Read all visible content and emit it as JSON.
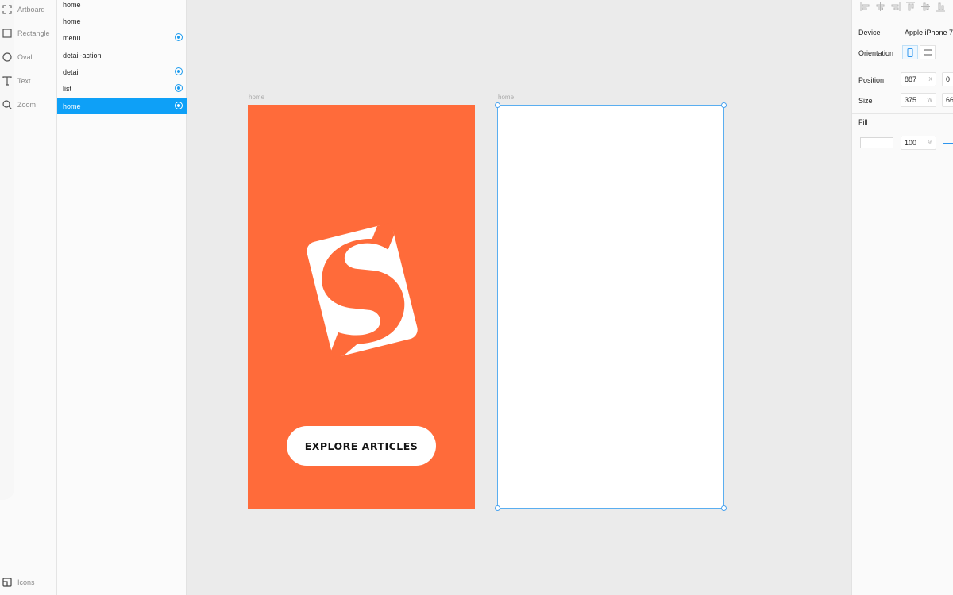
{
  "tools": [
    {
      "label": "Artboard",
      "icon": "artboard-icon"
    },
    {
      "label": "Rectangle",
      "icon": "rectangle-icon"
    },
    {
      "label": "Oval",
      "icon": "oval-icon"
    },
    {
      "label": "Text",
      "icon": "text-icon"
    },
    {
      "label": "Zoom",
      "icon": "zoom-icon"
    }
  ],
  "bottom_tool": {
    "label": "Icons",
    "icon": "icons-icon"
  },
  "layers": [
    {
      "label": "home",
      "link": false,
      "selected": false
    },
    {
      "label": "home",
      "link": false,
      "selected": false
    },
    {
      "label": "menu",
      "link": true,
      "selected": false
    },
    {
      "label": "detail-action",
      "link": false,
      "selected": false
    },
    {
      "label": "detail",
      "link": true,
      "selected": false
    },
    {
      "label": "list",
      "link": true,
      "selected": false
    },
    {
      "label": "home",
      "link": true,
      "selected": true
    }
  ],
  "canvas": {
    "artboards": [
      {
        "label": "home",
        "background": "#ff6b3a",
        "cta_label": "EXPLORE ARTICLES"
      },
      {
        "label": "home",
        "background": "#ffffff",
        "selected": true
      }
    ]
  },
  "inspector": {
    "device_label": "Device",
    "device_value": "Apple iPhone 7",
    "orientation_label": "Orientation",
    "position_label": "Position",
    "position_x": "887",
    "position_x_unit": "X",
    "position_y": "0",
    "size_label": "Size",
    "size_w": "375",
    "size_w_unit": "W",
    "size_h": "66",
    "fill_label": "Fill",
    "opacity": "100",
    "opacity_unit": "%"
  },
  "colors": {
    "accent": "#0ea0f7",
    "brand_orange": "#ff6b3a",
    "selection_border": "#5aaef0"
  }
}
